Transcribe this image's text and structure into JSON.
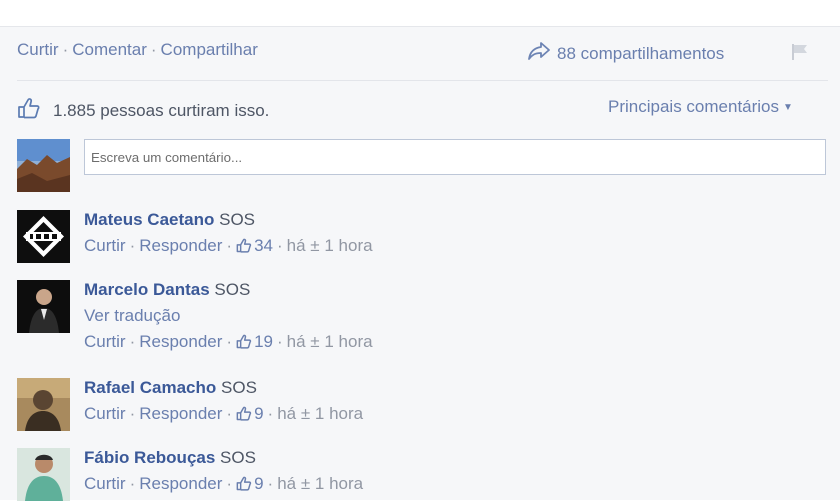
{
  "actions": {
    "like": "Curtir",
    "comment": "Comentar",
    "share": "Compartilhar",
    "separator": "·"
  },
  "shares": {
    "label": "88 compartilhamentos"
  },
  "likes": {
    "count_text": "1.885 pessoas",
    "rest": "curtiram isso."
  },
  "sort": {
    "label": "Principais comentários"
  },
  "composer": {
    "placeholder": "Escreva um comentário..."
  },
  "comments": [
    {
      "name": "Mateus Caetano",
      "text": "SOS",
      "reply": "Responder",
      "like": "Curtir",
      "likes": "34",
      "time": "há ± 1 hora",
      "avatar_color": "#111111"
    },
    {
      "name": "Marcelo Dantas",
      "text": "SOS",
      "translate": "Ver tradução",
      "reply": "Responder",
      "like": "Curtir",
      "likes": "19",
      "time": "há ± 1 hora",
      "avatar_color": "#222222"
    },
    {
      "name": "Rafael Camacho",
      "text": "SOS",
      "reply": "Responder",
      "like": "Curtir",
      "likes": "9",
      "time": "há ± 1 hora",
      "avatar_color": "#6b5a3a"
    },
    {
      "name": "Fábio Rebouças",
      "text": "SOS",
      "reply": "Responder",
      "like": "Curtir",
      "likes": "9",
      "time": "há ± 1 hora",
      "avatar_color": "#8fb7a6"
    }
  ],
  "icons": {
    "share": "share-arrow-icon",
    "flag": "flag-icon",
    "thumb": "thumbs-up-icon",
    "caret": "caret-down-icon"
  }
}
